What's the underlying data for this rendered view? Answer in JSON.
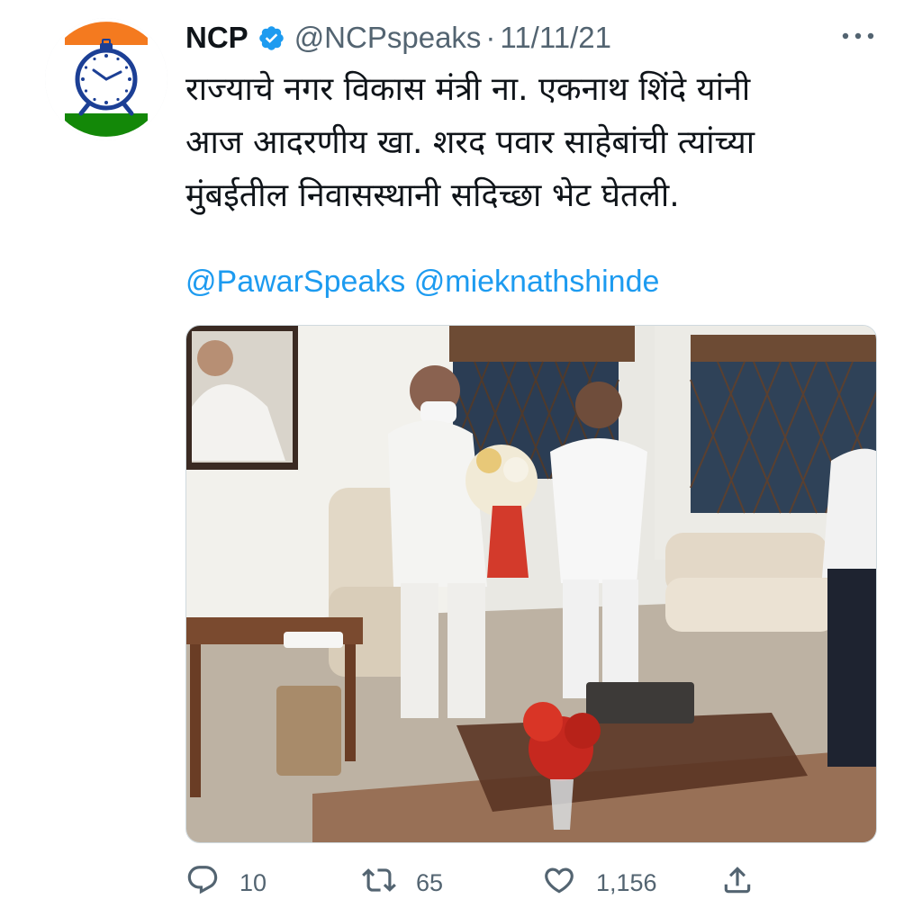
{
  "account": {
    "name": "NCP",
    "handle": "@NCPspeaks",
    "separator": "·",
    "date": "11/11/21"
  },
  "tweet": {
    "text": "राज्याचे नगर विकास मंत्री ना. एकनाथ शिंदे यांनी\nआज आदरणीय खा. शरद पवार साहेबांची त्यांच्या\nमुंबईतील निवासस्थानी सदिच्छा भेट घेतली.",
    "mentions": [
      "@PawarSpeaks",
      "@mieknathshinde"
    ]
  },
  "actions": {
    "replies": "10",
    "retweets": "65",
    "likes": "1,156"
  },
  "colors": {
    "accent": "#1d9bf0",
    "muted": "#536471",
    "saffron": "#f47a1f",
    "green": "#138808",
    "clock_blue": "#1c3f95"
  },
  "icons": [
    "verified-badge-icon",
    "more-icon",
    "reply-icon",
    "retweet-icon",
    "like-icon",
    "share-icon"
  ]
}
